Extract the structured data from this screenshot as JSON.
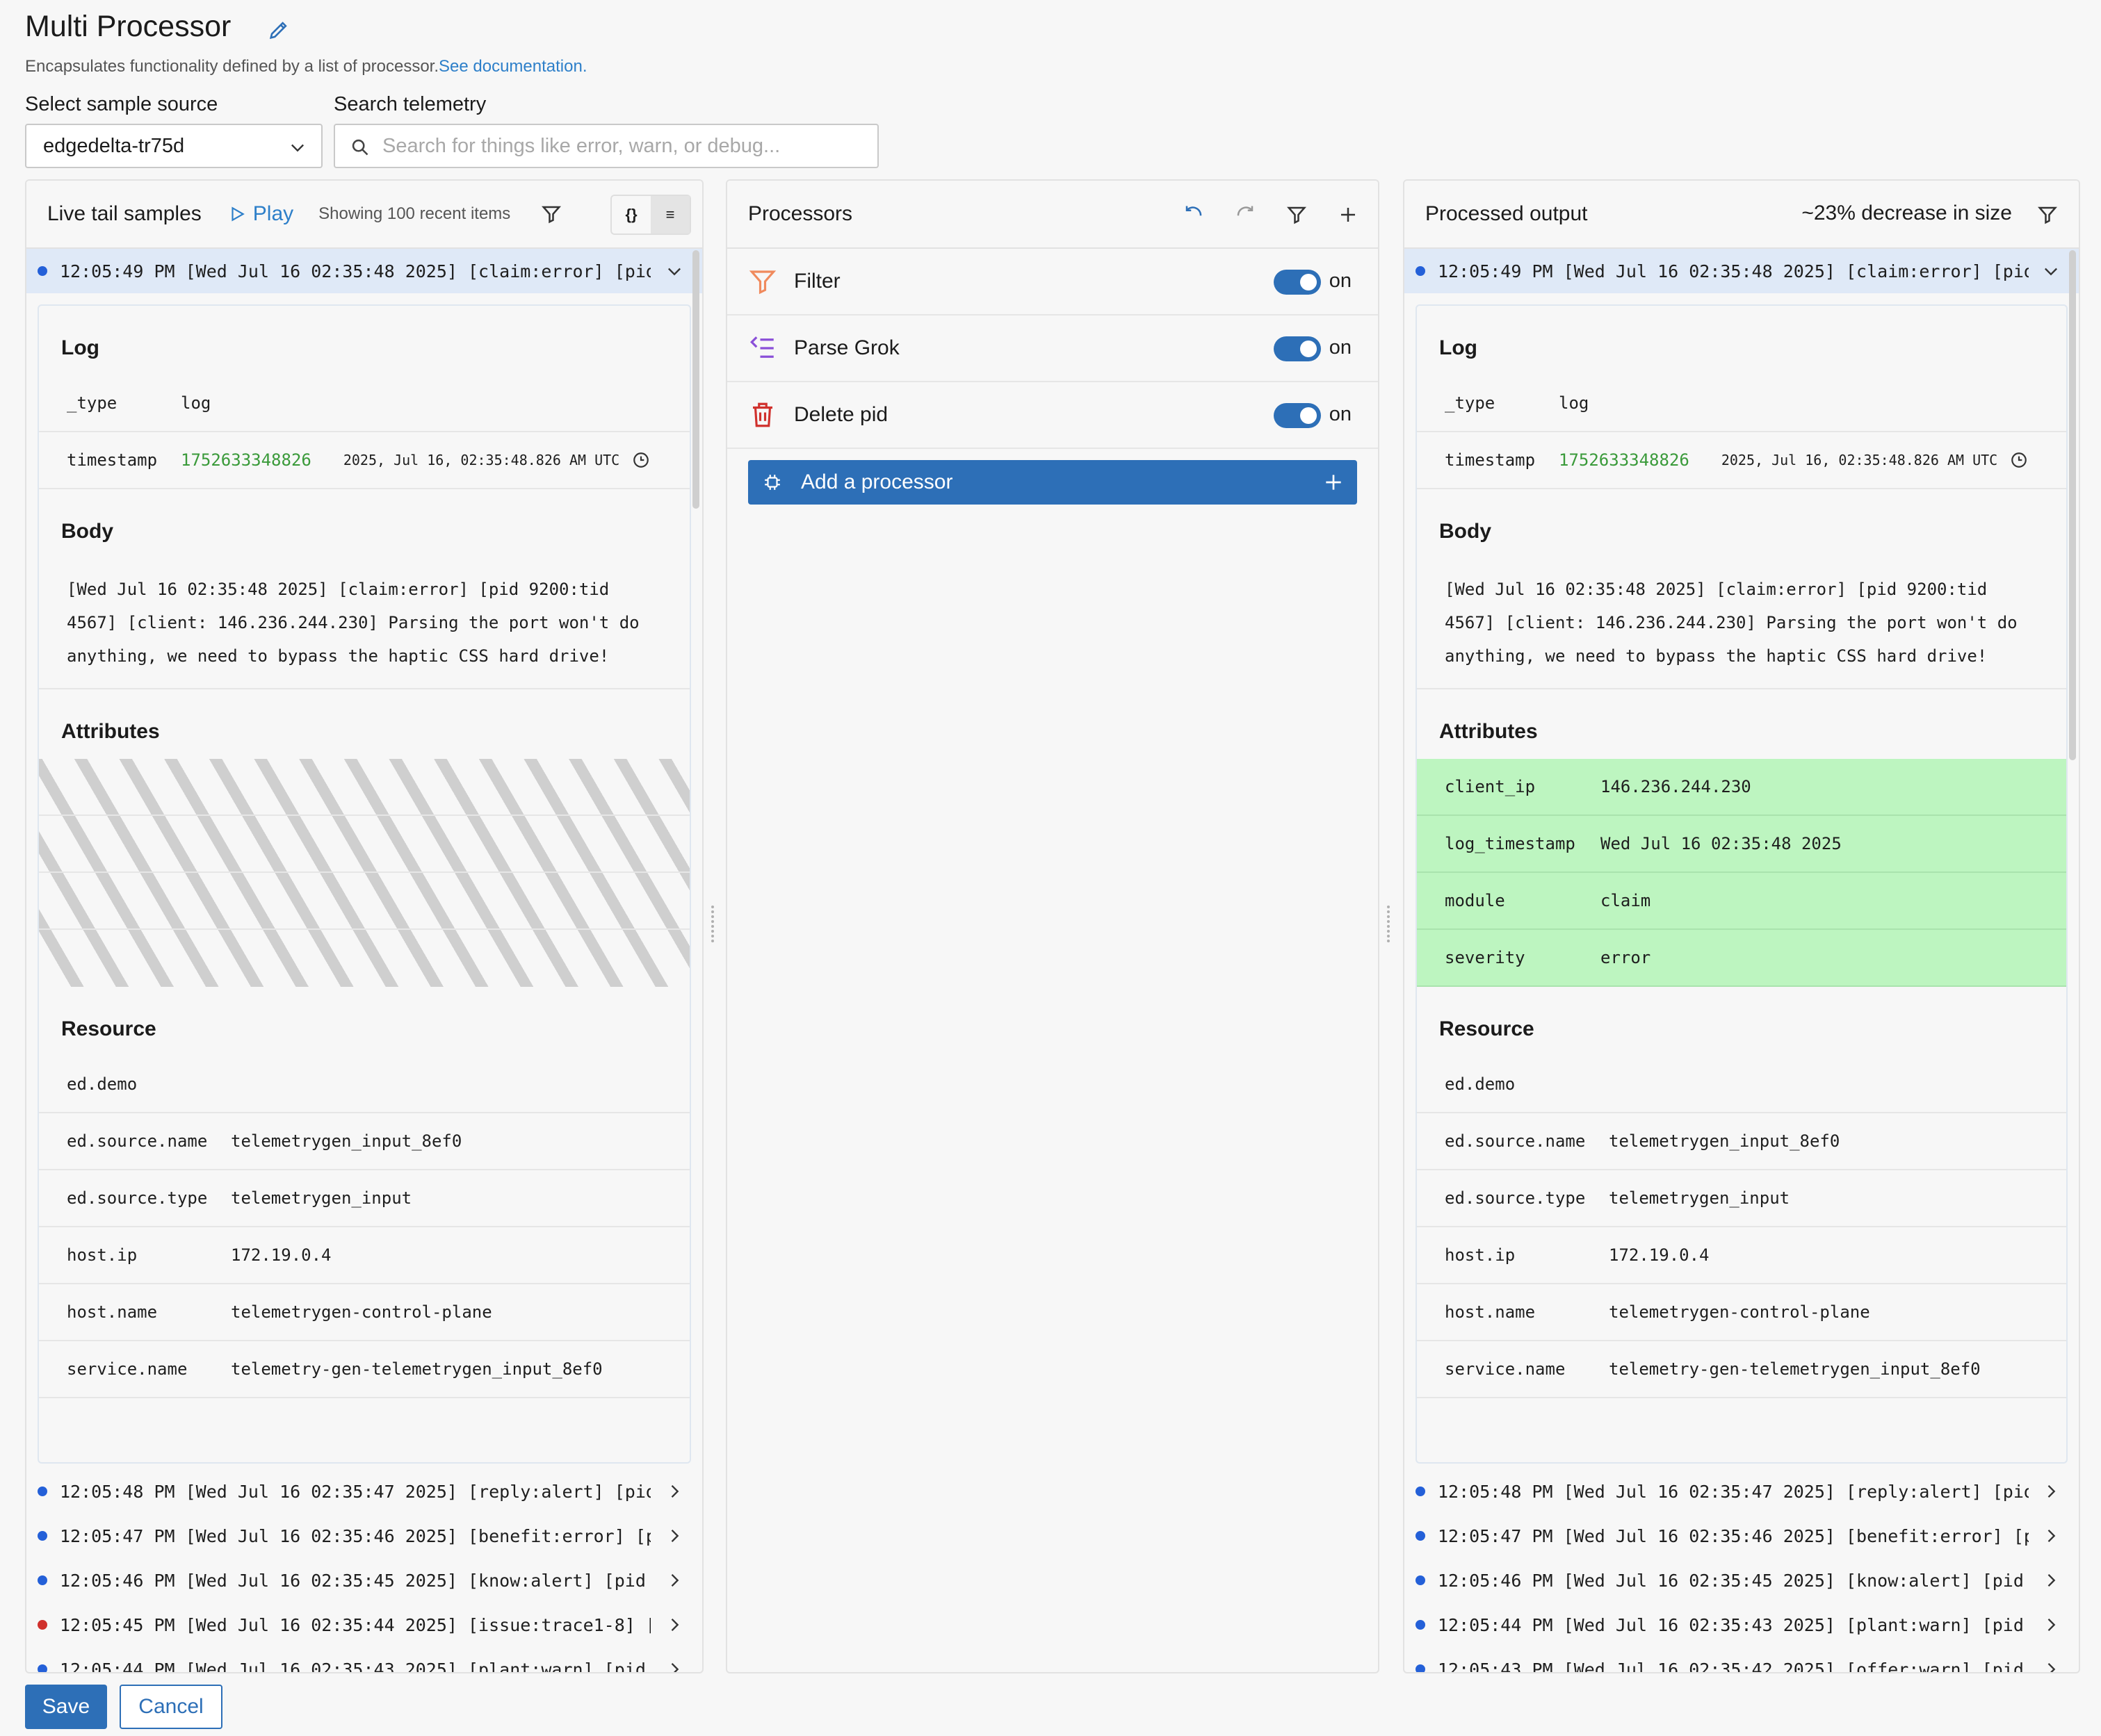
{
  "header": {
    "title": "Multi Processor",
    "description": "Encapsulates functionality defined by a list of processor.",
    "doc_link": "See documentation.",
    "source_label": "Select sample source",
    "source_value": "edgedelta-tr75d",
    "search_label": "Search telemetry",
    "search_placeholder": "Search for things like error, warn, or debug..."
  },
  "left": {
    "title": "Live tail samples",
    "play": "Play",
    "showing": "Showing 100 recent items",
    "view_json": "{}",
    "view_text": "≡",
    "selected_row": "12:05:49 PM [Wed Jul 16 02:35:48 2025] [claim:error] [pid…",
    "log": {
      "title": "Log",
      "type_key": "_type",
      "type_val": "log",
      "ts_key": "timestamp",
      "ts_val": "1752633348826",
      "ts_human": "2025, Jul 16, 02:35:48.826 AM UTC"
    },
    "body_title": "Body",
    "body_text": "[Wed Jul 16 02:35:48 2025] [claim:error] [pid 9200:tid\n4567] [client: 146.236.244.230] Parsing the port won't do\nanything, we need to bypass the haptic CSS hard drive!",
    "attributes_title": "Attributes",
    "resource_title": "Resource",
    "resource": [
      {
        "k": "ed.demo",
        "v": ""
      },
      {
        "k": "ed.source.name",
        "v": "telemetrygen_input_8ef0"
      },
      {
        "k": "ed.source.type",
        "v": "telemetrygen_input"
      },
      {
        "k": "host.ip",
        "v": "172.19.0.4"
      },
      {
        "k": "host.name",
        "v": "telemetrygen-control-plane"
      },
      {
        "k": "service.name",
        "v": "telemetry-gen-telemetrygen_input_8ef0"
      }
    ],
    "rows": [
      {
        "text": "12:05:48 PM [Wed Jul 16 02:35:47 2025] [reply:alert] [pid…",
        "level": "info"
      },
      {
        "text": "12:05:47 PM [Wed Jul 16 02:35:46 2025] [benefit:error] [p…",
        "level": "info"
      },
      {
        "text": "12:05:46 PM [Wed Jul 16 02:35:45 2025] [know:alert] [pid …",
        "level": "info"
      },
      {
        "text": "12:05:45 PM [Wed Jul 16 02:35:44 2025] [issue:trace1-8] […",
        "level": "error"
      },
      {
        "text": "12:05:44 PM [Wed Jul 16 02:35:43 2025] [plant:warn] [pid …",
        "level": "info"
      }
    ]
  },
  "processors": {
    "title": "Processors",
    "items": [
      {
        "name": "Filter",
        "state": "on",
        "icon": "funnel-icon",
        "color": "#f08a5d"
      },
      {
        "name": "Parse Grok",
        "state": "on",
        "icon": "list-parse-icon",
        "color": "#8a4fd8"
      },
      {
        "name": "Delete pid",
        "state": "on",
        "icon": "trash-icon",
        "color": "#d0312d"
      }
    ],
    "add_label": "Add a processor"
  },
  "right": {
    "title": "Processed output",
    "decrease": "~23% decrease in size",
    "selected_row": "12:05:49 PM [Wed Jul 16 02:35:48 2025] [claim:error] [pid…",
    "attributes": [
      {
        "k": "client_ip",
        "v": "146.236.244.230"
      },
      {
        "k": "log_timestamp",
        "v": "Wed Jul 16 02:35:48 2025"
      },
      {
        "k": "module",
        "v": "claim"
      },
      {
        "k": "severity",
        "v": "error"
      }
    ],
    "rows": [
      {
        "text": "12:05:48 PM [Wed Jul 16 02:35:47 2025] [reply:alert] [pid…",
        "level": "info"
      },
      {
        "text": "12:05:47 PM [Wed Jul 16 02:35:46 2025] [benefit:error] [p…",
        "level": "info"
      },
      {
        "text": "12:05:46 PM [Wed Jul 16 02:35:45 2025] [know:alert] [pid …",
        "level": "info"
      },
      {
        "text": "12:05:44 PM [Wed Jul 16 02:35:43 2025] [plant:warn] [pid …",
        "level": "info"
      },
      {
        "text": "12:05:43 PM [Wed Jul 16 02:35:42 2025] [offer:warn] [pid…",
        "level": "info"
      }
    ]
  },
  "footer": {
    "save": "Save",
    "cancel": "Cancel"
  },
  "colors": {
    "accent": "#2d6fb7",
    "link": "#2d7fc9",
    "added_attr": "#bdf5c0",
    "ts_green": "#3a9a3a"
  }
}
